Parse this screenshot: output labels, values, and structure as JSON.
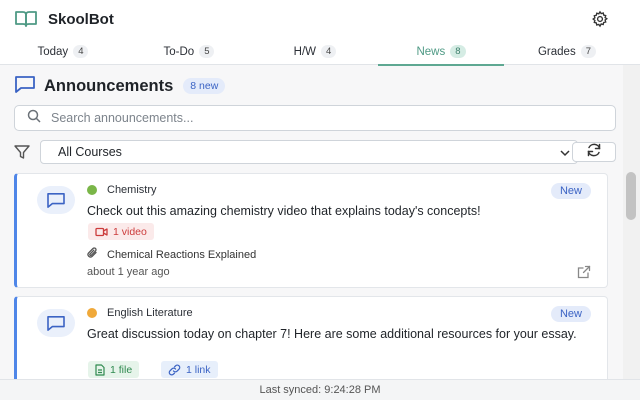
{
  "app": {
    "title": "SkoolBot",
    "accent": "#5ea892"
  },
  "tabs": [
    {
      "label": "Today",
      "count": "4"
    },
    {
      "label": "To-Do",
      "count": "5"
    },
    {
      "label": "H/W",
      "count": "4"
    },
    {
      "label": "News",
      "count": "8",
      "active": true
    },
    {
      "label": "Grades",
      "count": "7"
    }
  ],
  "announcements": {
    "title": "Announcements",
    "new_count": "8 new",
    "search_placeholder": "Search announcements...",
    "filter_selected": "All Courses",
    "items": [
      {
        "course": "Chemistry",
        "course_color": "#7ab648",
        "badge": "New",
        "message": "Check out this amazing chemistry video that explains today's concepts!",
        "chips": [
          {
            "type": "video",
            "label": "1 video"
          }
        ],
        "attachment": "Chemical Reactions Explained",
        "time": "about 1 year ago"
      },
      {
        "course": "English Literature",
        "course_color": "#f0a93a",
        "badge": "New",
        "message": "Great discussion today on chapter 7! Here are some additional resources for your essay.",
        "chips": [
          {
            "type": "file",
            "label": "1 file"
          },
          {
            "type": "link",
            "label": "1 link"
          }
        ]
      }
    ]
  },
  "footer": {
    "last_synced": "Last synced: 9:24:28 PM"
  }
}
